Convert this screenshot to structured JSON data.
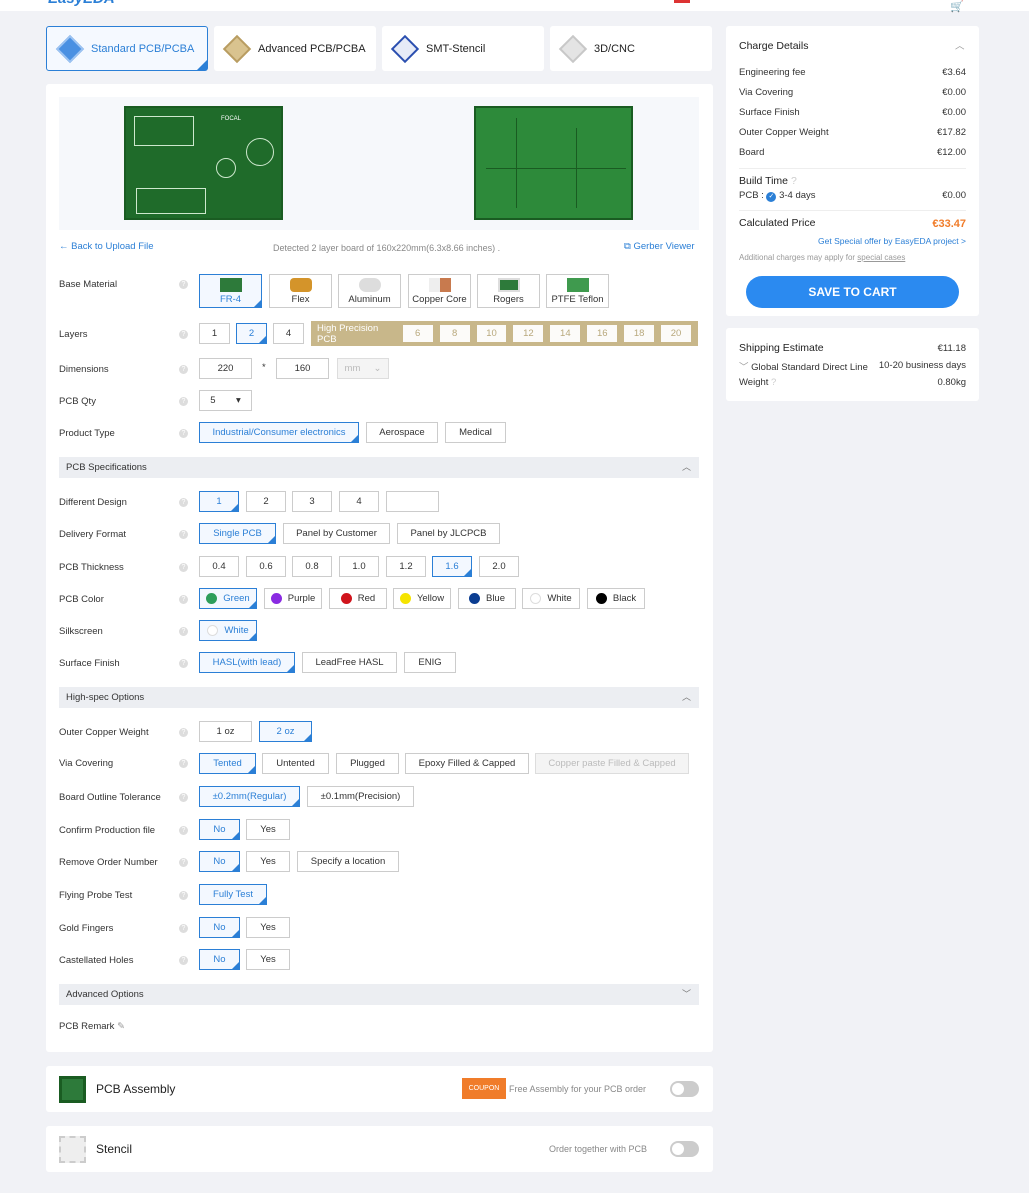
{
  "header": {
    "logo": "EasyEDA"
  },
  "tabs": [
    {
      "label": "Standard PCB/PCBA",
      "active": true,
      "color": "#2b7fd6"
    },
    {
      "label": "Advanced PCB/PCBA",
      "active": false,
      "color": "#c7a66a"
    },
    {
      "label": "SMT-Stencil",
      "active": false,
      "color": "#2b4fb0"
    },
    {
      "label": "3D/CNC",
      "active": false,
      "color": "#bbbbbb"
    }
  ],
  "upload": {
    "back_label": "Back to Upload File",
    "detected": "Detected 2 layer board of 160x220mm(6.3x8.66 inches) .",
    "gerber_viewer": "Gerber Viewer",
    "board_text": "FOCAL"
  },
  "base_material": {
    "label": "Base Material",
    "options": [
      "FR-4",
      "Flex",
      "Aluminum",
      "Copper Core",
      "Rogers",
      "PTFE Teflon"
    ],
    "selected": "FR-4"
  },
  "layers": {
    "label": "Layers",
    "options": [
      "1",
      "2",
      "4"
    ],
    "selected": "2",
    "high_precision_label": "High Precision PCB",
    "high_precision_options": [
      "6",
      "8",
      "10",
      "12",
      "14",
      "16",
      "18",
      "20"
    ]
  },
  "dimensions": {
    "label": "Dimensions",
    "width": "220",
    "separator": "*",
    "height": "160",
    "unit": "mm"
  },
  "pcb_qty": {
    "label": "PCB Qty",
    "value": "5"
  },
  "product_type": {
    "label": "Product Type",
    "options": [
      "Industrial/Consumer electronics",
      "Aerospace",
      "Medical"
    ],
    "selected": "Industrial/Consumer electronics"
  },
  "pcb_spec": {
    "title": "PCB Specifications"
  },
  "different_design": {
    "label": "Different Design",
    "options": [
      "1",
      "2",
      "3",
      "4",
      ""
    ],
    "selected": "1"
  },
  "delivery_format": {
    "label": "Delivery Format",
    "options": [
      "Single PCB",
      "Panel by Customer",
      "Panel by JLCPCB"
    ],
    "selected": "Single PCB"
  },
  "thickness": {
    "label": "PCB Thickness",
    "options": [
      "0.4",
      "0.6",
      "0.8",
      "1.0",
      "1.2",
      "1.6",
      "2.0"
    ],
    "selected": "1.6"
  },
  "pcb_color": {
    "label": "PCB Color",
    "options": [
      {
        "name": "Green",
        "hex": "#2e9e5b"
      },
      {
        "name": "Purple",
        "hex": "#8a2be2"
      },
      {
        "name": "Red",
        "hex": "#d0141c"
      },
      {
        "name": "Yellow",
        "hex": "#f5e400"
      },
      {
        "name": "Blue",
        "hex": "#0b3d91"
      },
      {
        "name": "White",
        "hex": "#ffffff"
      },
      {
        "name": "Black",
        "hex": "#000000"
      }
    ],
    "selected": "Green"
  },
  "silkscreen": {
    "label": "Silkscreen",
    "value": "White"
  },
  "surface_finish": {
    "label": "Surface Finish",
    "options": [
      "HASL(with lead)",
      "LeadFree HASL",
      "ENIG"
    ],
    "selected": "HASL(with lead)"
  },
  "high_spec": {
    "title": "High-spec Options"
  },
  "outer_copper": {
    "label": "Outer Copper Weight",
    "options": [
      "1 oz",
      "2 oz"
    ],
    "selected": "2 oz"
  },
  "via_covering": {
    "label": "Via Covering",
    "options": [
      "Tented",
      "Untented",
      "Plugged",
      "Epoxy Filled & Capped",
      "Copper paste Filled & Capped"
    ],
    "selected": "Tented"
  },
  "outline_tolerance": {
    "label": "Board Outline Tolerance",
    "options": [
      "±0.2mm(Regular)",
      "±0.1mm(Precision)"
    ],
    "selected": "±0.2mm(Regular)"
  },
  "confirm_file": {
    "label": "Confirm Production file",
    "options": [
      "No",
      "Yes"
    ],
    "selected": "No"
  },
  "remove_order": {
    "label": "Remove Order Number",
    "options": [
      "No",
      "Yes",
      "Specify a location"
    ],
    "selected": "No"
  },
  "flying_probe": {
    "label": "Flying Probe Test",
    "value": "Fully Test"
  },
  "gold_fingers": {
    "label": "Gold Fingers",
    "options": [
      "No",
      "Yes"
    ],
    "selected": "No"
  },
  "castellated": {
    "label": "Castellated Holes",
    "options": [
      "No",
      "Yes"
    ],
    "selected": "No"
  },
  "advanced": {
    "title": "Advanced Options"
  },
  "remark": {
    "label": "PCB Remark"
  },
  "charge": {
    "title": "Charge Details",
    "rows": [
      {
        "name": "Engineering fee",
        "value": "€3.64"
      },
      {
        "name": "Via Covering",
        "value": "€0.00"
      },
      {
        "name": "Surface Finish",
        "value": "€0.00"
      },
      {
        "name": "Outer Copper Weight",
        "value": "€17.82"
      },
      {
        "name": "Board",
        "value": "€12.00"
      }
    ],
    "build_time": "Build Time",
    "pcb_label": "PCB :",
    "pcb_days": "3-4 days",
    "pcb_value": "€0.00",
    "calc_label": "Calculated Price",
    "calc_value": "€33.47",
    "special_offer": "Get Special offer by EasyEDA project >",
    "note_prefix": "Additional charges may apply for ",
    "note_link": "special cases",
    "save_button": "SAVE TO CART"
  },
  "shipping": {
    "title": "Shipping Estimate",
    "value": "€11.18",
    "method": "Global Standard Direct Line",
    "days": "10-20 business days",
    "weight_label": "Weight",
    "weight": "0.80kg"
  },
  "assembly": {
    "title": "PCB Assembly",
    "coupon": "COUPON",
    "promo": "Free Assembly for your PCB order"
  },
  "stencil": {
    "title": "Stencil",
    "note": "Order together with PCB"
  }
}
